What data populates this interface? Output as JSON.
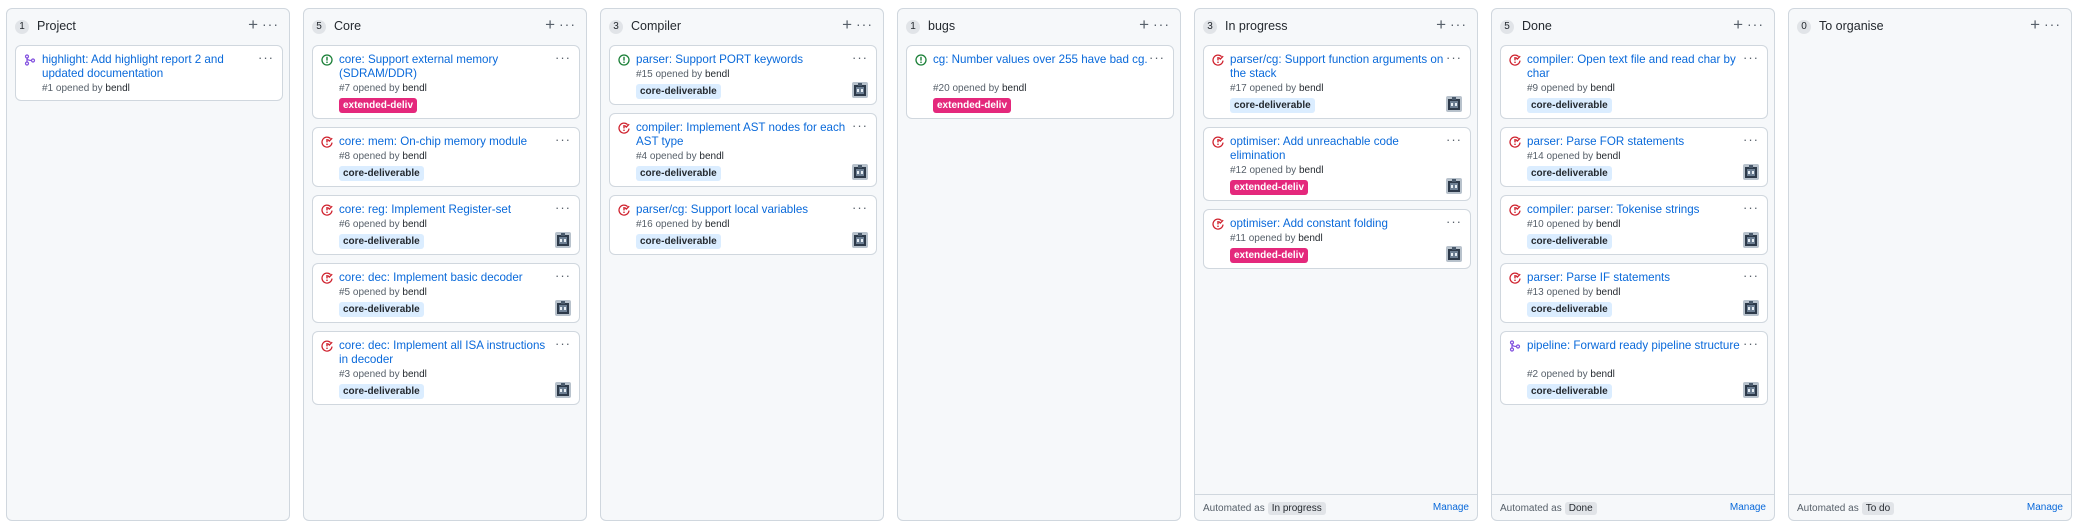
{
  "colors": {
    "open": "#1a7f37",
    "closed": "#cf222e",
    "merged": "#8250df",
    "link": "#0969da",
    "label_core_bg": "#dbedff",
    "label_ext_bg": "#e4287c"
  },
  "opened_by_text": "opened by",
  "columns": [
    {
      "name": "Project",
      "count": "1",
      "add_icon": "plus-icon",
      "more_icon": "kebab-icon",
      "cards": [
        {
          "state": "merged",
          "icon": "pull-request-merged-icon",
          "title": "highlight: Add highlight report 2 and updated documentation",
          "number": "#1",
          "author": "bendl",
          "label": "",
          "avatar": false
        }
      ]
    },
    {
      "name": "Core",
      "count": "5",
      "cards": [
        {
          "state": "open",
          "icon": "issue-opened-icon",
          "title": "core: Support external memory (SDRAM/DDR)",
          "number": "#7",
          "author": "bendl",
          "label": "extended-deliv",
          "avatar": false
        },
        {
          "state": "closed",
          "icon": "issue-closed-icon",
          "title": "core: mem: On-chip memory module",
          "number": "#8",
          "author": "bendl",
          "label": "core-deliverable",
          "avatar": false
        },
        {
          "state": "closed",
          "icon": "issue-closed-icon",
          "title": "core: reg: Implement Register-set",
          "number": "#6",
          "author": "bendl",
          "label": "core-deliverable",
          "avatar": true
        },
        {
          "state": "closed",
          "icon": "issue-closed-icon",
          "title": "core: dec: Implement basic decoder",
          "number": "#5",
          "author": "bendl",
          "label": "core-deliverable",
          "avatar": true
        },
        {
          "state": "closed",
          "icon": "issue-closed-icon",
          "title": "core: dec: Implement all ISA instructions in decoder",
          "number": "#3",
          "author": "bendl",
          "label": "core-deliverable",
          "avatar": true
        }
      ]
    },
    {
      "name": "Compiler",
      "count": "3",
      "cards": [
        {
          "state": "open",
          "icon": "issue-opened-icon",
          "title": "parser: Support PORT keywords",
          "number": "#15",
          "author": "bendl",
          "label": "core-deliverable",
          "avatar": true
        },
        {
          "state": "closed",
          "icon": "issue-closed-icon",
          "title": "compiler: Implement AST nodes for each AST type",
          "number": "#4",
          "author": "bendl",
          "label": "core-deliverable",
          "avatar": true
        },
        {
          "state": "closed",
          "icon": "issue-closed-icon",
          "title": "parser/cg: Support local variables",
          "number": "#16",
          "author": "bendl",
          "label": "core-deliverable",
          "avatar": true
        }
      ]
    },
    {
      "name": "bugs",
      "count": "1",
      "cards": [
        {
          "state": "open",
          "icon": "issue-opened-icon",
          "title": "cg: Number values over 255 have bad cg.",
          "number": "#20",
          "author": "bendl",
          "label": "extended-deliv",
          "avatar": false
        }
      ]
    },
    {
      "name": "In progress",
      "count": "3",
      "footer": {
        "automated": "Automated as",
        "badge": "In progress",
        "manage": "Manage"
      },
      "cards": [
        {
          "state": "closed",
          "icon": "issue-closed-icon",
          "title": "parser/cg: Support function arguments on the stack",
          "number": "#17",
          "author": "bendl",
          "label": "core-deliverable",
          "avatar": true
        },
        {
          "state": "closed",
          "icon": "issue-closed-icon",
          "title": "optimiser: Add unreachable code elimination",
          "number": "#12",
          "author": "bendl",
          "label": "extended-deliv",
          "avatar": true
        },
        {
          "state": "closed",
          "icon": "issue-closed-icon",
          "title": "optimiser: Add constant folding",
          "number": "#11",
          "author": "bendl",
          "label": "extended-deliv",
          "avatar": true
        }
      ]
    },
    {
      "name": "Done",
      "count": "5",
      "footer": {
        "automated": "Automated as",
        "badge": "Done",
        "manage": "Manage"
      },
      "cards": [
        {
          "state": "closed",
          "icon": "issue-closed-icon",
          "title": "compiler: Open text file and read char by char",
          "number": "#9",
          "author": "bendl",
          "label": "core-deliverable",
          "avatar": false
        },
        {
          "state": "closed",
          "icon": "issue-closed-icon",
          "title": "parser: Parse FOR statements",
          "number": "#14",
          "author": "bendl",
          "label": "core-deliverable",
          "avatar": true
        },
        {
          "state": "closed",
          "icon": "issue-closed-icon",
          "title": "compiler: parser: Tokenise strings",
          "number": "#10",
          "author": "bendl",
          "label": "core-deliverable",
          "avatar": true
        },
        {
          "state": "closed",
          "icon": "issue-closed-icon",
          "title": "parser: Parse IF statements",
          "number": "#13",
          "author": "bendl",
          "label": "core-deliverable",
          "avatar": true
        },
        {
          "state": "merged",
          "icon": "pull-request-merged-icon",
          "title": "pipeline: Forward ready pipeline structure",
          "number": "#2",
          "author": "bendl",
          "label": "core-deliverable",
          "avatar": true
        }
      ]
    },
    {
      "name": "To organise",
      "count": "0",
      "footer": {
        "automated": "Automated as",
        "badge": "To do",
        "manage": "Manage"
      },
      "cards": []
    }
  ]
}
